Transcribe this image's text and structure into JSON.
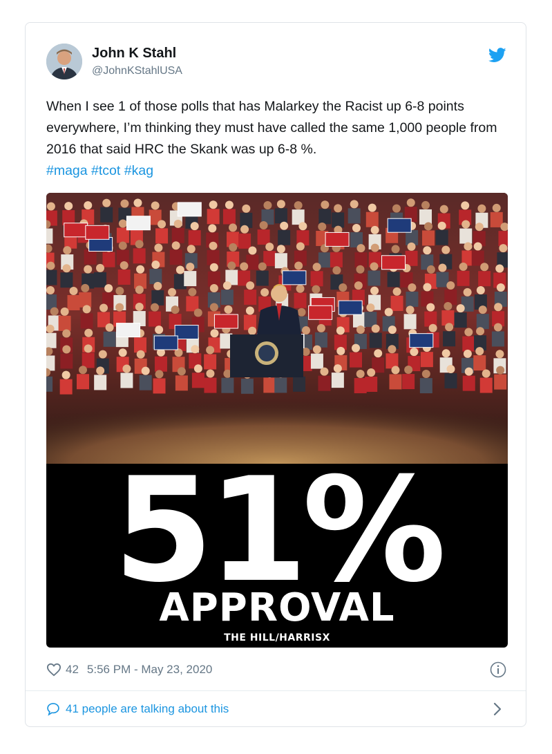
{
  "tweet": {
    "author_name": "John K Stahl",
    "author_handle": "@JohnKStahlUSA",
    "text": "When I see 1 of those polls that has Malarkey the Racist up 6-8 points everywhere, I’m thinking they must have called the same 1,000 people from 2016 that said HRC the Skank was up 6-8 %.",
    "hashtags": [
      "#maga",
      "#tcot",
      "#kag"
    ],
    "likes": "42",
    "timestamp": "5:56 PM - May 23, 2020",
    "talking": "41 people are talking about this"
  },
  "media": {
    "headline": "51%",
    "subheadline": "APPROVAL",
    "source": "THE HILL/HARRISX"
  },
  "icons": {
    "logo": "twitter-bird-icon",
    "like": "heart-icon",
    "info": "info-icon",
    "reply": "speech-bubble-icon",
    "more": "chevron-right-icon"
  },
  "colors": {
    "link": "#1b95e0",
    "secondary_text": "#657786",
    "media_background": "#000000"
  }
}
